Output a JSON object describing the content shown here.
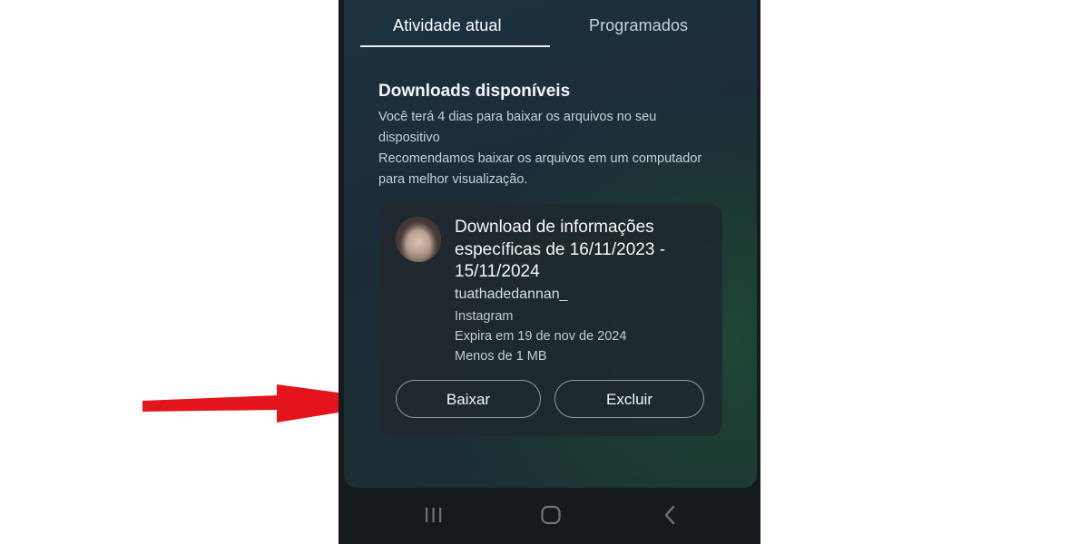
{
  "tabs": [
    {
      "label": "Atividade atual",
      "active": true
    },
    {
      "label": "Programados",
      "active": false
    }
  ],
  "section": {
    "title": "Downloads disponíveis",
    "description_lines": [
      "Você terá 4 dias para baixar os arquivos no seu dispositivo",
      "Recomendamos baixar os arquivos em um computador para melhor visualização."
    ]
  },
  "download_card": {
    "title": "Download de informações específicas de 16/11/2023 - 15/11/2024",
    "username": "tuathadedannan_",
    "platform": "Instagram",
    "expires": "Expira em 19 de nov de 2024",
    "size": "Menos de 1 MB",
    "download_label": "Baixar",
    "delete_label": "Excluir"
  },
  "navbar": {
    "icons": [
      "recent-apps-icon",
      "home-icon",
      "back-icon"
    ]
  },
  "colors": {
    "annotation_arrow": "#e3141b",
    "screen_bg": "#1c2f3b",
    "card_bg": "#1e282e"
  }
}
